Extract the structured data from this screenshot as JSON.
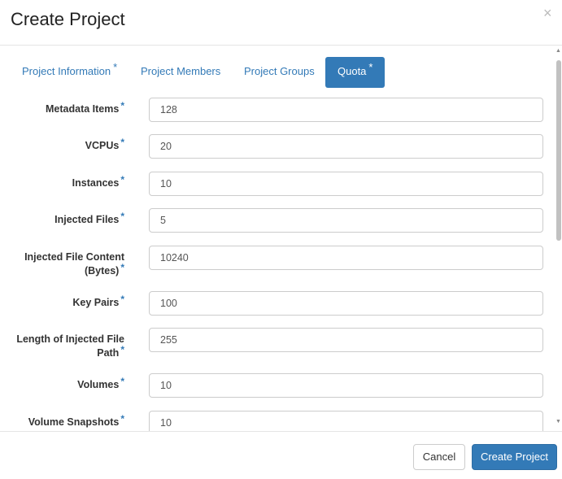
{
  "dialog": {
    "title": "Create Project",
    "close_symbol": "×"
  },
  "tabs": [
    {
      "label": "Project Information",
      "required": "*"
    },
    {
      "label": "Project Members",
      "required": ""
    },
    {
      "label": "Project Groups",
      "required": ""
    },
    {
      "label": "Quota",
      "required": "*",
      "active": true
    }
  ],
  "fields": [
    {
      "label": "Metadata Items",
      "value": "128",
      "required": "*"
    },
    {
      "label": "VCPUs",
      "value": "20",
      "required": "*"
    },
    {
      "label": "Instances",
      "value": "10",
      "required": "*"
    },
    {
      "label": "Injected Files",
      "value": "5",
      "required": "*"
    },
    {
      "label_line1": "Injected File Content",
      "label_line2": "(Bytes)",
      "value": "10240",
      "required": "*"
    },
    {
      "label": "Key Pairs",
      "value": "100",
      "required": "*"
    },
    {
      "label_line1": "Length of Injected File",
      "label_line2": "Path",
      "value": "255",
      "required": "*"
    },
    {
      "label": "Volumes",
      "value": "10",
      "required": "*"
    },
    {
      "label": "Volume Snapshots",
      "value": "10",
      "required": "*"
    }
  ],
  "footer": {
    "cancel_label": "Cancel",
    "create_label": "Create Project"
  },
  "colors": {
    "accent": "#337ab7",
    "border": "#cccccc"
  },
  "icons": {
    "close": "close-icon",
    "scroll_up": "scroll-up-icon",
    "scroll_down": "scroll-down-icon"
  }
}
